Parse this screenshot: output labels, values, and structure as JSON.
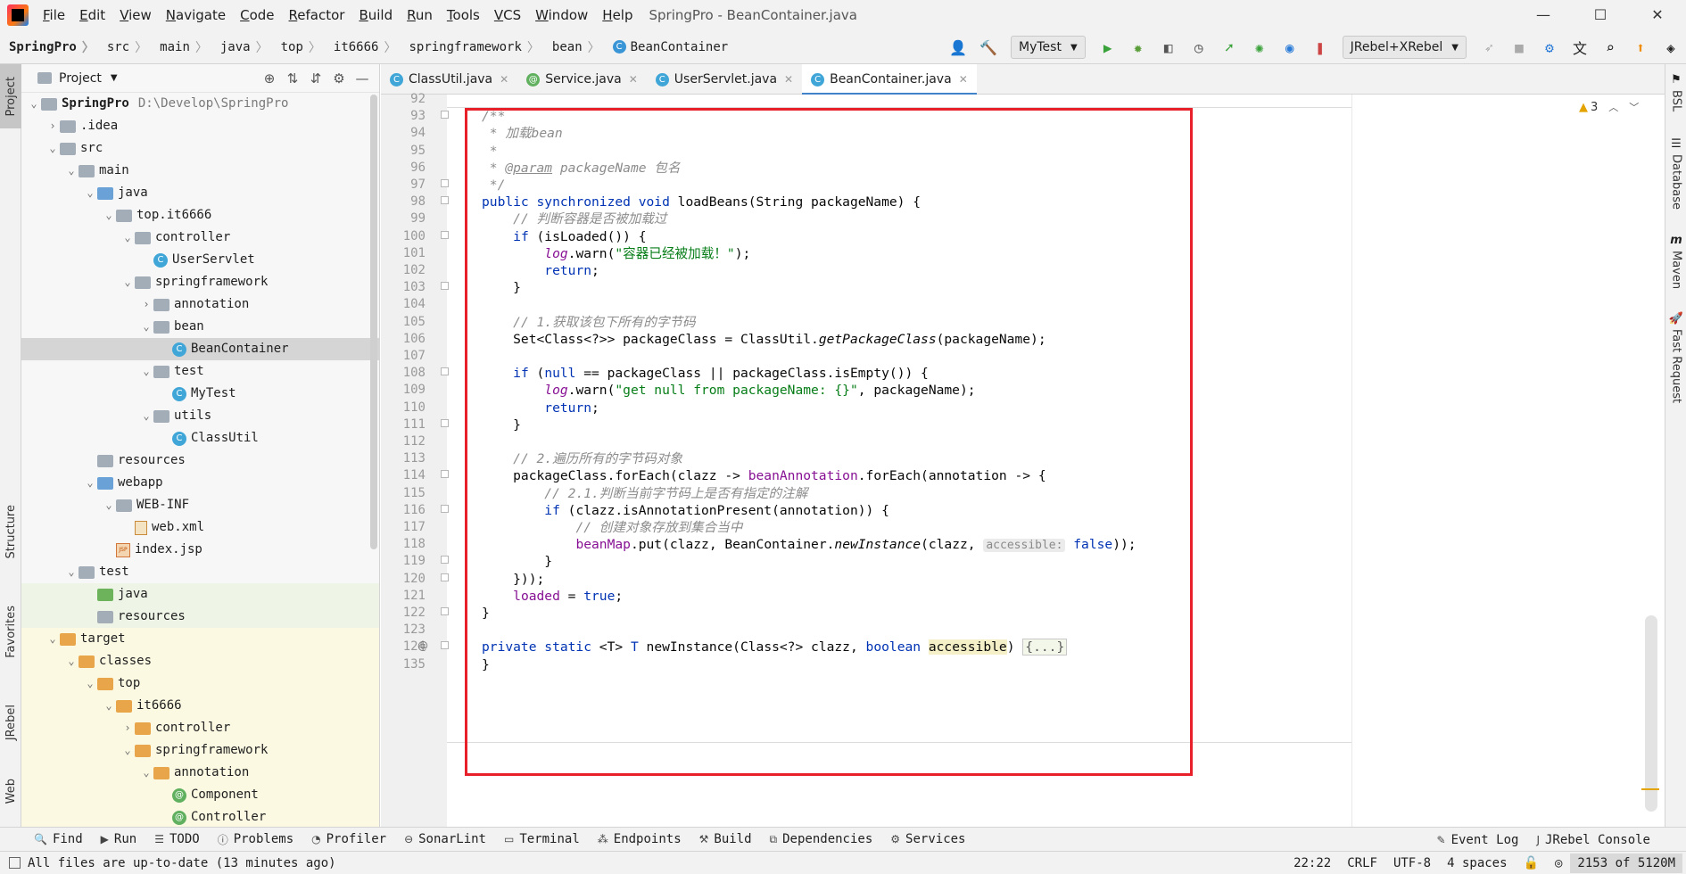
{
  "window": {
    "title": "SpringPro - BeanContainer.java",
    "menu": [
      "File",
      "Edit",
      "View",
      "Navigate",
      "Code",
      "Refactor",
      "Build",
      "Run",
      "Tools",
      "VCS",
      "Window",
      "Help"
    ],
    "controls": [
      "—",
      "☐",
      "✕"
    ]
  },
  "breadcrumb": [
    "SpringPro",
    "src",
    "main",
    "java",
    "top",
    "it6666",
    "springframework",
    "bean",
    "BeanContainer"
  ],
  "toolbar": {
    "run_config": "MyTest",
    "jrebel_config": "JRebel+XRebel"
  },
  "left_strip": [
    "Project",
    "Structure",
    "Favorites",
    "JRebel",
    "Web"
  ],
  "right_strip": [
    "BSL",
    "Database",
    "Maven",
    "Fast Request"
  ],
  "project": {
    "header": "Project",
    "tree": [
      {
        "label": "SpringPro",
        "path": "D:\\Develop\\SpringPro",
        "icon": "folder",
        "depth": 0,
        "arrow": "▾"
      },
      {
        "label": ".idea",
        "icon": "folder",
        "depth": 1,
        "arrow": "›"
      },
      {
        "label": "src",
        "icon": "folder",
        "depth": 1,
        "arrow": "▾"
      },
      {
        "label": "main",
        "icon": "folder",
        "depth": 2,
        "arrow": "▾"
      },
      {
        "label": "java",
        "icon": "folder-src",
        "depth": 3,
        "arrow": "▾"
      },
      {
        "label": "top.it6666",
        "icon": "folder-pkg",
        "depth": 4,
        "arrow": "▾"
      },
      {
        "label": "controller",
        "icon": "folder-pkg",
        "depth": 5,
        "arrow": "▾"
      },
      {
        "label": "UserServlet",
        "icon": "cls",
        "depth": 6,
        "arrow": ""
      },
      {
        "label": "springframework",
        "icon": "folder-pkg",
        "depth": 5,
        "arrow": "▾"
      },
      {
        "label": "annotation",
        "icon": "folder-pkg",
        "depth": 6,
        "arrow": "›"
      },
      {
        "label": "bean",
        "icon": "folder-pkg",
        "depth": 6,
        "arrow": "▾"
      },
      {
        "label": "BeanContainer",
        "icon": "cls",
        "depth": 7,
        "arrow": "",
        "selected": true
      },
      {
        "label": "test",
        "icon": "folder-pkg",
        "depth": 6,
        "arrow": "▾"
      },
      {
        "label": "MyTest",
        "icon": "cls",
        "depth": 7,
        "arrow": ""
      },
      {
        "label": "utils",
        "icon": "folder-pkg",
        "depth": 6,
        "arrow": "▾"
      },
      {
        "label": "ClassUtil",
        "icon": "cls",
        "depth": 7,
        "arrow": ""
      },
      {
        "label": "resources",
        "icon": "folder-res",
        "depth": 3,
        "arrow": ""
      },
      {
        "label": "webapp",
        "icon": "folder-src",
        "depth": 3,
        "arrow": "▾"
      },
      {
        "label": "WEB-INF",
        "icon": "folder",
        "depth": 4,
        "arrow": "▾"
      },
      {
        "label": "web.xml",
        "icon": "xml",
        "depth": 5,
        "arrow": ""
      },
      {
        "label": "index.jsp",
        "icon": "jsp",
        "depth": 4,
        "arrow": ""
      },
      {
        "label": "test",
        "icon": "folder",
        "depth": 2,
        "arrow": "▾"
      },
      {
        "label": "java",
        "icon": "folder-test",
        "depth": 3,
        "arrow": "",
        "bg": "test"
      },
      {
        "label": "resources",
        "icon": "folder-res",
        "depth": 3,
        "arrow": "",
        "bg": "test"
      },
      {
        "label": "target",
        "icon": "folder-target",
        "depth": 1,
        "arrow": "▾",
        "bg": "target"
      },
      {
        "label": "classes",
        "icon": "folder-target",
        "depth": 2,
        "arrow": "▾",
        "bg": "target"
      },
      {
        "label": "top",
        "icon": "folder-target",
        "depth": 3,
        "arrow": "▾",
        "bg": "target"
      },
      {
        "label": "it6666",
        "icon": "folder-target",
        "depth": 4,
        "arrow": "▾",
        "bg": "target"
      },
      {
        "label": "controller",
        "icon": "folder-target",
        "depth": 5,
        "arrow": "›",
        "bg": "target"
      },
      {
        "label": "springframework",
        "icon": "folder-target",
        "depth": 5,
        "arrow": "▾",
        "bg": "target"
      },
      {
        "label": "annotation",
        "icon": "folder-target",
        "depth": 6,
        "arrow": "▾",
        "bg": "target"
      },
      {
        "label": "Component",
        "icon": "ann",
        "depth": 7,
        "arrow": "",
        "bg": "target"
      },
      {
        "label": "Controller",
        "icon": "ann",
        "depth": 7,
        "arrow": "",
        "bg": "target"
      }
    ]
  },
  "tabs": [
    {
      "label": "ClassUtil.java",
      "icon": "cls",
      "active": false
    },
    {
      "label": "Service.java",
      "icon": "ann",
      "active": false
    },
    {
      "label": "UserServlet.java",
      "icon": "cls",
      "active": false
    },
    {
      "label": "BeanContainer.java",
      "icon": "cls",
      "active": true
    }
  ],
  "inspections": {
    "warnings": "3"
  },
  "code": {
    "line_numbers": [
      "92",
      "93",
      "94",
      "95",
      "96",
      "97",
      "98",
      "99",
      "100",
      "101",
      "102",
      "103",
      "104",
      "105",
      "106",
      "107",
      "108",
      "109",
      "110",
      "111",
      "112",
      "113",
      "114",
      "115",
      "116",
      "117",
      "118",
      "119",
      "120",
      "121",
      "122",
      "123",
      "124",
      "135"
    ],
    "lines": [
      [],
      [
        {
          "c": "cm",
          "t": "/**"
        }
      ],
      [
        {
          "c": "cm",
          "t": " * 加载bean"
        }
      ],
      [
        {
          "c": "cm",
          "t": " *"
        }
      ],
      [
        {
          "c": "cm",
          "t": " * "
        },
        {
          "c": "cmtag",
          "t": "@param"
        },
        {
          "c": "cm",
          "t": " packageName 包名"
        }
      ],
      [
        {
          "c": "cm",
          "t": " */"
        }
      ],
      [
        {
          "c": "kw",
          "t": "public synchronized void "
        },
        {
          "c": "",
          "t": "loadBeans(String packageName) {"
        }
      ],
      [
        {
          "c": "",
          "t": "    "
        },
        {
          "c": "cm",
          "t": "// 判断容器是否被加载过"
        }
      ],
      [
        {
          "c": "",
          "t": "    "
        },
        {
          "c": "kw",
          "t": "if "
        },
        {
          "c": "",
          "t": "(isLoaded()) {"
        }
      ],
      [
        {
          "c": "",
          "t": "        "
        },
        {
          "c": "fld ital",
          "t": "log"
        },
        {
          "c": "",
          "t": ".warn("
        },
        {
          "c": "st",
          "t": "\"容器已经被加载！\""
        },
        {
          "c": "",
          "t": ");"
        }
      ],
      [
        {
          "c": "",
          "t": "        "
        },
        {
          "c": "kw",
          "t": "return"
        },
        {
          "c": "",
          "t": ";"
        }
      ],
      [
        {
          "c": "",
          "t": "    }"
        }
      ],
      [],
      [
        {
          "c": "",
          "t": "    "
        },
        {
          "c": "cm",
          "t": "// 1.获取该包下所有的字节码"
        }
      ],
      [
        {
          "c": "",
          "t": "    Set<Class<?>> packageClass = ClassUtil."
        },
        {
          "c": "ital",
          "t": "getPackageClass"
        },
        {
          "c": "",
          "t": "(packageName);"
        }
      ],
      [],
      [
        {
          "c": "",
          "t": "    "
        },
        {
          "c": "kw",
          "t": "if "
        },
        {
          "c": "",
          "t": "("
        },
        {
          "c": "kw",
          "t": "null"
        },
        {
          "c": "",
          "t": " == packageClass || packageClass.isEmpty()) {"
        }
      ],
      [
        {
          "c": "",
          "t": "        "
        },
        {
          "c": "fld ital",
          "t": "log"
        },
        {
          "c": "",
          "t": ".warn("
        },
        {
          "c": "st",
          "t": "\"get null from packageName: {}\""
        },
        {
          "c": "",
          "t": ", packageName);"
        }
      ],
      [
        {
          "c": "",
          "t": "        "
        },
        {
          "c": "kw",
          "t": "return"
        },
        {
          "c": "",
          "t": ";"
        }
      ],
      [
        {
          "c": "",
          "t": "    }"
        }
      ],
      [],
      [
        {
          "c": "",
          "t": "    "
        },
        {
          "c": "cm",
          "t": "// 2.遍历所有的字节码对象"
        }
      ],
      [
        {
          "c": "",
          "t": "    packageClass.forEach(clazz -> "
        },
        {
          "c": "fld",
          "t": "beanAnnotation"
        },
        {
          "c": "",
          "t": ".forEach(annotation -> {"
        }
      ],
      [
        {
          "c": "",
          "t": "        "
        },
        {
          "c": "cm",
          "t": "// 2.1.判断当前字节码上是否有指定的注解"
        }
      ],
      [
        {
          "c": "",
          "t": "        "
        },
        {
          "c": "kw",
          "t": "if "
        },
        {
          "c": "",
          "t": "(clazz.isAnnotationPresent(annotation)) {"
        }
      ],
      [
        {
          "c": "",
          "t": "            "
        },
        {
          "c": "cm",
          "t": "// 创建对象存放到集合当中"
        }
      ],
      [
        {
          "c": "",
          "t": "            "
        },
        {
          "c": "fld",
          "t": "beanMap"
        },
        {
          "c": "",
          "t": ".put(clazz, BeanContainer."
        },
        {
          "c": "ital",
          "t": "newInstance"
        },
        {
          "c": "",
          "t": "(clazz, "
        },
        {
          "c": "hint",
          "t": "accessible:"
        },
        {
          "c": "",
          "t": " "
        },
        {
          "c": "kw",
          "t": "false"
        },
        {
          "c": "",
          "t": "));"
        }
      ],
      [
        {
          "c": "",
          "t": "        }"
        }
      ],
      [
        {
          "c": "",
          "t": "    }));"
        }
      ],
      [
        {
          "c": "",
          "t": "    "
        },
        {
          "c": "fld",
          "t": "loaded"
        },
        {
          "c": "",
          "t": " = "
        },
        {
          "c": "kw",
          "t": "true"
        },
        {
          "c": "",
          "t": ";"
        }
      ],
      [
        {
          "c": "",
          "t": "}"
        }
      ],
      [],
      [
        {
          "c": "kw",
          "t": "private static "
        },
        {
          "c": "",
          "t": "<T> "
        },
        {
          "c": "kw",
          "t": "T "
        },
        {
          "c": "",
          "t": "newInstance(Class<?> clazz, "
        },
        {
          "c": "kw",
          "t": "boolean "
        },
        {
          "c": "hl",
          "t": "accessible"
        },
        {
          "c": "",
          "t": ") "
        },
        {
          "c": "fold-box",
          "t": "{...}"
        }
      ],
      [
        {
          "c": "",
          "t": "}"
        }
      ]
    ]
  },
  "bottom_tools": [
    {
      "icon": "🔍",
      "label": "Find"
    },
    {
      "icon": "▶",
      "label": "Run"
    },
    {
      "icon": "☰",
      "label": "TODO"
    },
    {
      "icon": "ⓘ",
      "label": "Problems"
    },
    {
      "icon": "◔",
      "label": "Profiler"
    },
    {
      "icon": "⊖",
      "label": "SonarLint"
    },
    {
      "icon": "▭",
      "label": "Terminal"
    },
    {
      "icon": "⁂",
      "label": "Endpoints"
    },
    {
      "icon": "⚒",
      "label": "Build"
    },
    {
      "icon": "⧉",
      "label": "Dependencies"
    },
    {
      "icon": "⚙",
      "label": "Services"
    }
  ],
  "bottom_right_tools": [
    {
      "icon": "✎",
      "label": "Event Log"
    },
    {
      "icon": "J",
      "label": "JRebel Console"
    }
  ],
  "status": {
    "message": "All files are up-to-date (13 minutes ago)",
    "position": "22:22",
    "line_sep": "CRLF",
    "encoding": "UTF-8",
    "indent": "4 spaces",
    "memory": "2153 of 5120M"
  }
}
